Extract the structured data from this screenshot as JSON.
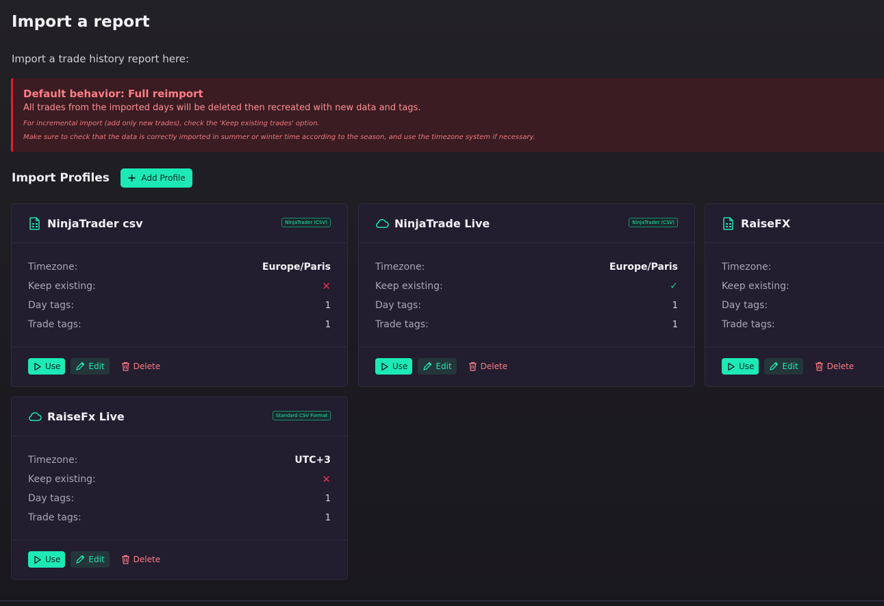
{
  "page": {
    "title": "Import a report",
    "subtitle": "Import a trade history report here:"
  },
  "alert": {
    "title": "Default behavior: Full reimport",
    "body": "All trades from the imported days will be deleted then recreated with new data and tags.",
    "note1": "For incremental import (add only new trades), check the 'Keep existing trades' option.",
    "note2": "Make sure to check that the data is correctly imported in summer or winter time according to the season, and use the timezone system if necessary."
  },
  "profiles": {
    "title": "Import Profiles",
    "add_label": "Add Profile",
    "labels": {
      "timezone": "Timezone:",
      "keep": "Keep existing:",
      "day_tags": "Day tags:",
      "trade_tags": "Trade tags:",
      "use": "Use",
      "edit": "Edit",
      "delete": "Delete"
    },
    "items": [
      {
        "name": "NinjaTrader csv",
        "icon": "file-csv-icon",
        "badge": "NinjaTrader (CSV)",
        "timezone": "Europe/Paris",
        "keep_existing": "✕",
        "day_tags": "1",
        "trade_tags": "1"
      },
      {
        "name": "NinjaTrade Live",
        "icon": "cloud-icon",
        "badge": "NinjaTrader (CSV)",
        "timezone": "Europe/Paris",
        "keep_existing": "✓",
        "day_tags": "1",
        "trade_tags": "1"
      },
      {
        "name": "RaiseFX",
        "icon": "file-csv-icon",
        "badge": "",
        "timezone": "",
        "keep_existing": "",
        "day_tags": "",
        "trade_tags": ""
      },
      {
        "name": "RaiseFx Live",
        "icon": "cloud-icon",
        "badge": "Standard CSV Format",
        "timezone": "UTC+3",
        "keep_existing": "✕",
        "day_tags": "1",
        "trade_tags": "1"
      }
    ]
  },
  "colors": {
    "accent": "#1de9b6",
    "danger": "#e01e37",
    "success": "#22c98a"
  }
}
